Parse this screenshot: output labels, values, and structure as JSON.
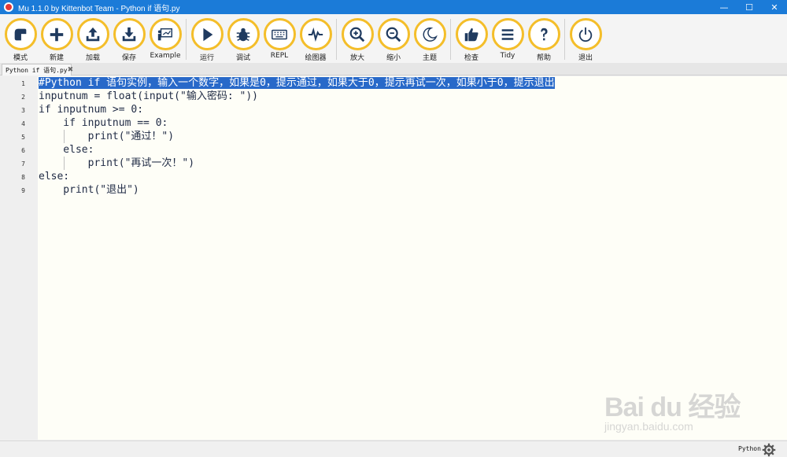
{
  "window": {
    "title": "Mu 1.1.0 by Kittenbot Team - Python if 语句.py",
    "controls": [
      "—",
      "☐",
      "✕"
    ]
  },
  "toolbar": {
    "buttons": [
      {
        "label": "模式",
        "icon": "mode-icon"
      },
      {
        "label": "新建",
        "icon": "plus-icon"
      },
      {
        "label": "加载",
        "icon": "upload-icon"
      },
      {
        "label": "保存",
        "icon": "download-icon"
      },
      {
        "label": "Example",
        "icon": "presentation-icon"
      },
      {
        "label": "运行",
        "icon": "play-icon"
      },
      {
        "label": "调试",
        "icon": "bug-icon"
      },
      {
        "label": "REPL",
        "icon": "keyboard-icon"
      },
      {
        "label": "绘图器",
        "icon": "pulse-icon"
      },
      {
        "label": "放大",
        "icon": "zoom-in-icon"
      },
      {
        "label": "缩小",
        "icon": "zoom-out-icon"
      },
      {
        "label": "主题",
        "icon": "moon-icon"
      },
      {
        "label": "检查",
        "icon": "thumbs-up-icon"
      },
      {
        "label": "Tidy",
        "icon": "lines-icon"
      },
      {
        "label": "帮助",
        "icon": "question-icon"
      },
      {
        "label": "退出",
        "icon": "power-icon"
      }
    ]
  },
  "tabs": [
    {
      "label": "Python if 语句.py",
      "close": "✖"
    }
  ],
  "editor": {
    "lines": [
      {
        "n": "1",
        "text": "#Python if 语句实例，输入一个数字，如果是0，提示通过，如果大于0，提示再试一次，如果小于0，提示退出"
      },
      {
        "n": "2",
        "text": "inputnum = float(input(\"输入密码: \"))"
      },
      {
        "n": "3",
        "text": "if inputnum >= 0:"
      },
      {
        "n": "4",
        "text": "    if inputnum == 0:"
      },
      {
        "n": "5",
        "text": "        print(\"通过！\")"
      },
      {
        "n": "6",
        "text": "    else:"
      },
      {
        "n": "7",
        "text": "        print(\"再试一次！\")"
      },
      {
        "n": "8",
        "text": "else:"
      },
      {
        "n": "9",
        "text": "    print(\"退出\")"
      }
    ]
  },
  "statusbar": {
    "mode": "Python"
  },
  "watermark": {
    "line1": "Bai du 经验",
    "line2": "jingyan.baidu.com"
  },
  "colors": {
    "titlebar": "#1b7bd8",
    "button_ring": "#f4be2a",
    "selection": "#2869c9"
  }
}
